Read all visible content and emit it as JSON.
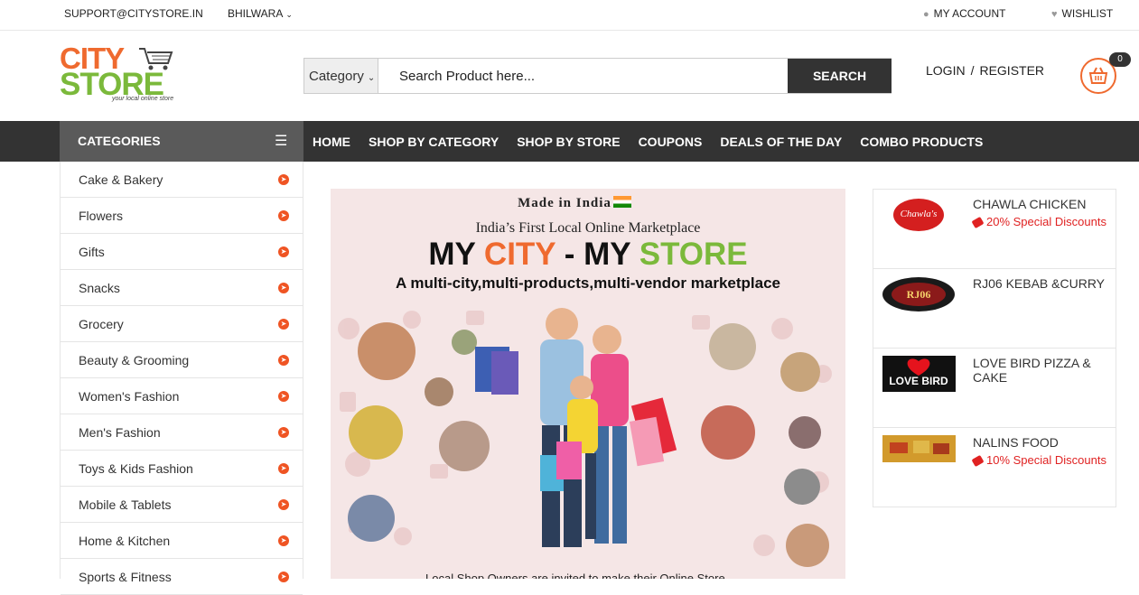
{
  "topbar": {
    "email": "SUPPORT@CITYSTORE.IN",
    "city": "BHILWARA",
    "account": "MY ACCOUNT",
    "wishlist": "WISHLIST"
  },
  "logo": {
    "line1": "CITY",
    "line2": "STORE",
    "tagline": "your local online store"
  },
  "search": {
    "category": "Category",
    "placeholder": "Search Product here...",
    "button": "SEARCH"
  },
  "auth": {
    "login": "LOGIN",
    "separator": "/",
    "register": "REGISTER"
  },
  "cart": {
    "count": "0"
  },
  "nav": {
    "categories_label": "CATEGORIES",
    "links": [
      "HOME",
      "SHOP BY CATEGORY",
      "SHOP BY STORE",
      "COUPONS",
      "DEALS OF THE DAY",
      "COMBO PRODUCTS"
    ]
  },
  "sidebar": {
    "items": [
      "Cake & Bakery",
      "Flowers",
      "Gifts",
      "Snacks",
      "Grocery",
      "Beauty & Grooming",
      "Women's Fashion",
      "Men's Fashion",
      "Toys & Kids Fashion",
      "Mobile & Tablets",
      "Home & Kitchen",
      "Sports & Fitness"
    ]
  },
  "banner": {
    "made_in": "Made in India",
    "subtitle": "India’s First Local Online Marketplace",
    "headline_part1": "MY ",
    "headline_city": "CITY",
    "headline_part2": " - MY ",
    "headline_store": "STORE",
    "tagline": "A multi-city,multi-products,multi-vendor marketplace",
    "bottom_text": "Local Shop Owners are invited to make their Online Store"
  },
  "stores": [
    {
      "name": "CHAWLA CHICKEN",
      "discount": "20% Special Discounts",
      "logo_text": "Chawla's"
    },
    {
      "name": "RJ06 KEBAB &CURRY",
      "discount": "",
      "logo_text": "RJ06"
    },
    {
      "name": "LOVE BIRD PIZZA & CAKE",
      "discount": "",
      "logo_text": "LOVE BIRD"
    },
    {
      "name": "NALINS FOOD",
      "discount": "10% Special Discounts",
      "logo_text": ""
    }
  ],
  "colors": {
    "brand_orange": "#ef6a2f",
    "brand_green": "#7bb93b",
    "nav_dark": "#333333",
    "discount_red": "#e02222"
  }
}
